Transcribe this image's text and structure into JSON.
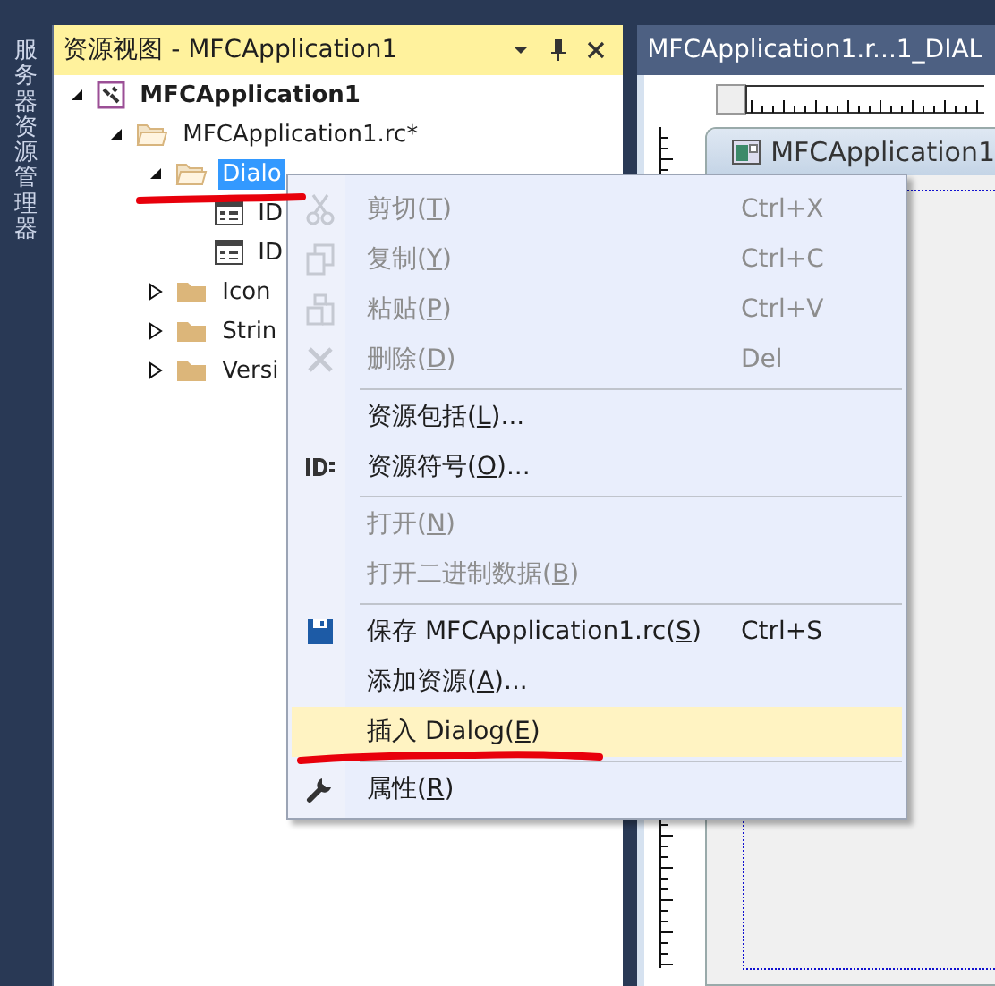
{
  "side_tab": {
    "label": "服务器资源管理器"
  },
  "panel": {
    "title": "资源视图 - MFCApplication1"
  },
  "tree": [
    {
      "label": "MFCApplication1",
      "bold": true,
      "expanded": true,
      "selected": false,
      "kind": "project",
      "children": [
        {
          "label": "MFCApplication1.rc*",
          "bold": false,
          "expanded": true,
          "selected": false,
          "kind": "folder",
          "children": [
            {
              "label": "Dialo",
              "bold": false,
              "expanded": true,
              "selected": true,
              "marked": true,
              "kind": "folder",
              "children": [
                {
                  "label": "ID",
                  "bold": false,
                  "selected": false,
                  "kind": "dialog"
                },
                {
                  "label": "ID",
                  "bold": false,
                  "selected": false,
                  "kind": "dialog"
                }
              ]
            },
            {
              "label": "Icon",
              "bold": false,
              "expanded": false,
              "selected": false,
              "kind": "folder"
            },
            {
              "label": "Strin",
              "bold": false,
              "expanded": false,
              "selected": false,
              "kind": "folder"
            },
            {
              "label": "Versi",
              "bold": false,
              "expanded": false,
              "selected": false,
              "kind": "folder"
            }
          ]
        }
      ]
    }
  ],
  "editor": {
    "tab_title": "MFCApplication1.r...1_DIAL",
    "dialog_title": "MFCApplication1"
  },
  "context_menu": [
    {
      "kind": "item",
      "before": "剪切(",
      "key": "T",
      "after": ")",
      "shortcut": "Ctrl+X",
      "disabled": true,
      "highlighted": false
    },
    {
      "kind": "item",
      "before": "复制(",
      "key": "Y",
      "after": ")",
      "shortcut": "Ctrl+C",
      "disabled": true,
      "highlighted": false
    },
    {
      "kind": "item",
      "before": "粘贴(",
      "key": "P",
      "after": ")",
      "shortcut": "Ctrl+V",
      "disabled": true,
      "highlighted": false
    },
    {
      "kind": "item",
      "before": "删除(",
      "key": "D",
      "after": ")",
      "shortcut": "Del",
      "disabled": true,
      "highlighted": false
    },
    {
      "kind": "separator"
    },
    {
      "kind": "item",
      "before": "资源包括(",
      "key": "L",
      "after": ")...",
      "disabled": false,
      "highlighted": false
    },
    {
      "kind": "item",
      "before": "资源符号(",
      "key": "O",
      "after": ")...",
      "disabled": false,
      "highlighted": false
    },
    {
      "kind": "separator"
    },
    {
      "kind": "item",
      "before": "打开(",
      "key": "N",
      "after": ")",
      "disabled": true,
      "highlighted": false
    },
    {
      "kind": "item",
      "before": "打开二进制数据(",
      "key": "B",
      "after": ")",
      "disabled": true,
      "highlighted": false
    },
    {
      "kind": "separator"
    },
    {
      "kind": "item",
      "before": "保存 MFCApplication1.rc(",
      "key": "S",
      "after": ")",
      "shortcut": "Ctrl+S",
      "disabled": false,
      "highlighted": false
    },
    {
      "kind": "item",
      "before": "添加资源(",
      "key": "A",
      "after": ")...",
      "disabled": false,
      "highlighted": false
    },
    {
      "kind": "item",
      "before": "插入 Dialog(",
      "key": "E",
      "after": ")",
      "disabled": false,
      "highlighted": true,
      "marked": true
    },
    {
      "kind": "separator"
    },
    {
      "kind": "item",
      "before": "属性(",
      "key": "R",
      "after": ")",
      "disabled": false,
      "highlighted": false
    }
  ]
}
